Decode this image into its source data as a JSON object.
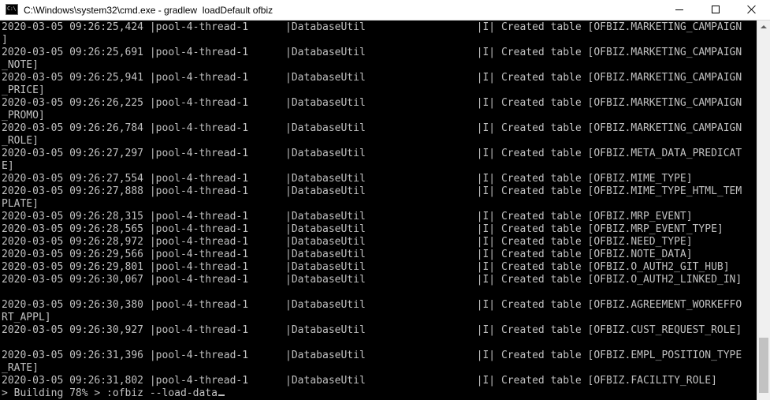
{
  "window": {
    "title": "C:\\Windows\\system32\\cmd.exe - gradlew  loadDefault ofbiz",
    "icon_label": "C:\\",
    "icons": {
      "app": "cmd-icon",
      "minimize": "minimize-icon",
      "maximize": "maximize-icon",
      "close": "close-icon",
      "scroll_up": "arrow-up-icon"
    }
  },
  "console": {
    "lines": [
      "2020-03-05 09:26:25,424 |pool-4-thread-1      |DatabaseUtil                  |I| Created table [OFBIZ.MARKETING_CAMPAIGN",
      "]",
      "2020-03-05 09:26:25,691 |pool-4-thread-1      |DatabaseUtil                  |I| Created table [OFBIZ.MARKETING_CAMPAIGN",
      "_NOTE]",
      "2020-03-05 09:26:25,941 |pool-4-thread-1      |DatabaseUtil                  |I| Created table [OFBIZ.MARKETING_CAMPAIGN",
      "_PRICE]",
      "2020-03-05 09:26:26,225 |pool-4-thread-1      |DatabaseUtil                  |I| Created table [OFBIZ.MARKETING_CAMPAIGN",
      "_PROMO]",
      "2020-03-05 09:26:26,784 |pool-4-thread-1      |DatabaseUtil                  |I| Created table [OFBIZ.MARKETING_CAMPAIGN",
      "_ROLE]",
      "2020-03-05 09:26:27,297 |pool-4-thread-1      |DatabaseUtil                  |I| Created table [OFBIZ.META_DATA_PREDICAT",
      "E]",
      "2020-03-05 09:26:27,554 |pool-4-thread-1      |DatabaseUtil                  |I| Created table [OFBIZ.MIME_TYPE]",
      "2020-03-05 09:26:27,888 |pool-4-thread-1      |DatabaseUtil                  |I| Created table [OFBIZ.MIME_TYPE_HTML_TEM",
      "PLATE]",
      "2020-03-05 09:26:28,315 |pool-4-thread-1      |DatabaseUtil                  |I| Created table [OFBIZ.MRP_EVENT]",
      "2020-03-05 09:26:28,565 |pool-4-thread-1      |DatabaseUtil                  |I| Created table [OFBIZ.MRP_EVENT_TYPE]",
      "2020-03-05 09:26:28,972 |pool-4-thread-1      |DatabaseUtil                  |I| Created table [OFBIZ.NEED_TYPE]",
      "2020-03-05 09:26:29,566 |pool-4-thread-1      |DatabaseUtil                  |I| Created table [OFBIZ.NOTE_DATA]",
      "2020-03-05 09:26:29,801 |pool-4-thread-1      |DatabaseUtil                  |I| Created table [OFBIZ.O_AUTH2_GIT_HUB]",
      "2020-03-05 09:26:30,067 |pool-4-thread-1      |DatabaseUtil                  |I| Created table [OFBIZ.O_AUTH2_LINKED_IN]",
      "",
      "2020-03-05 09:26:30,380 |pool-4-thread-1      |DatabaseUtil                  |I| Created table [OFBIZ.AGREEMENT_WORKEFFO",
      "RT_APPL]",
      "2020-03-05 09:26:30,927 |pool-4-thread-1      |DatabaseUtil                  |I| Created table [OFBIZ.CUST_REQUEST_ROLE]",
      "",
      "2020-03-05 09:26:31,396 |pool-4-thread-1      |DatabaseUtil                  |I| Created table [OFBIZ.EMPL_POSITION_TYPE",
      "_RATE]",
      "2020-03-05 09:26:31,802 |pool-4-thread-1      |DatabaseUtil                  |I| Created table [OFBIZ.FACILITY_ROLE]"
    ],
    "status_line": "> Building 78% > :ofbiz --load-data"
  }
}
